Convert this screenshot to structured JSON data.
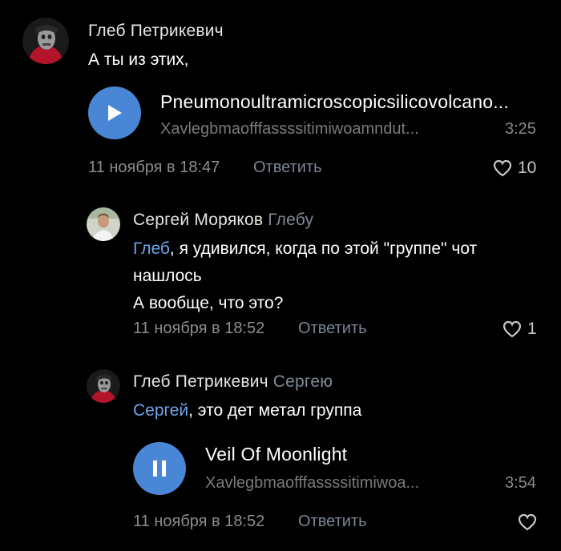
{
  "colors": {
    "background": "#000000",
    "accent": "#4a86d6",
    "mention": "#6ea6ea",
    "secondary_text": "#8c8c8c"
  },
  "comments": [
    {
      "author": "Глеб Петрикевич",
      "reply_to": "",
      "text_lines": [
        "А ты из этих,"
      ],
      "audio": {
        "title": "Pneumonoultramicroscopicsilicovolcano...",
        "artist": "Xavlegbmaofffassssitimiwoamndut...",
        "duration": "3:25",
        "state": "paused",
        "icon": "play-icon"
      },
      "date": "11 ноября в 18:47",
      "reply_label": "Ответить",
      "likes": "10"
    },
    {
      "author": "Сергей Моряков",
      "reply_to": "Глебу",
      "mention": "Глеб",
      "text_lines": [
        ", я удивился, когда по этой \"группе\" чот",
        "нашлось",
        "А вообще, что это?"
      ],
      "date": "11 ноября в 18:52",
      "reply_label": "Ответить",
      "likes": "1"
    },
    {
      "author": "Глеб Петрикевич",
      "reply_to": "Сергею",
      "mention": "Сергей",
      "text_lines": [
        ", это дет метал группа"
      ],
      "audio": {
        "title": "Veil Of Moonlight",
        "artist": "Xavlegbmaofffassssitimiwoa...",
        "duration": "3:54",
        "state": "playing",
        "icon": "pause-icon"
      },
      "date": "11 ноября в 18:52",
      "reply_label": "Ответить",
      "likes": ""
    }
  ]
}
